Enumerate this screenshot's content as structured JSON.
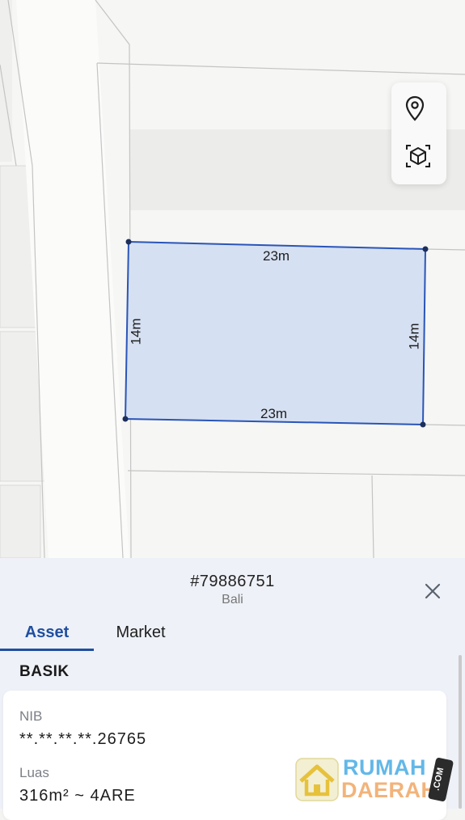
{
  "map": {
    "controls": {
      "pin_icon": "map-pin-icon",
      "box_icon": "3d-box-icon"
    },
    "plot": {
      "dimensions": {
        "top": "23m",
        "bottom": "23m",
        "left": "14m",
        "right": "14m"
      },
      "fill_color": "#d5e0f2",
      "border_color": "#2a55b8"
    }
  },
  "sheet": {
    "plot_id": "#79886751",
    "region": "Bali",
    "tabs": [
      {
        "label": "Asset",
        "active": true
      },
      {
        "label": "Market",
        "active": false
      }
    ],
    "section_title": "BASIK",
    "fields": [
      {
        "label": "NIB",
        "value": "**.**.**.**.26765"
      },
      {
        "label": "Luas",
        "value": "316m² ~ 4ARE"
      }
    ]
  },
  "watermark": {
    "line1": "RUMAH",
    "line2": "DAERAH",
    "suffix": ".COM"
  },
  "colors": {
    "accent": "#1f4fa0",
    "sheet_bg": "#eef1f7",
    "map_bg": "#f6f6f4"
  }
}
